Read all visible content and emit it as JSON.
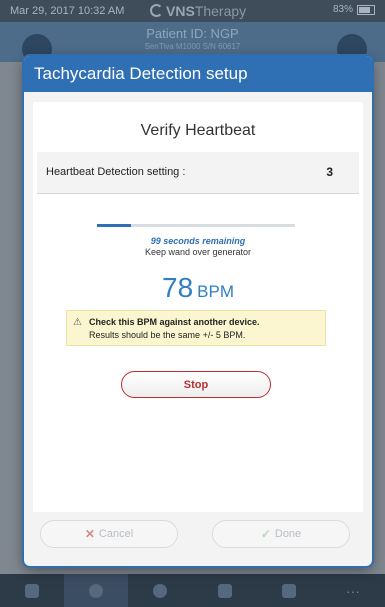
{
  "statusbar": {
    "time": "Mar 29, 2017  10:32 AM",
    "brand_bold": "VNS",
    "brand_thin": "Therapy",
    "battery": "83%"
  },
  "background": {
    "patient_id": "Patient ID: NGP",
    "model": "SenTiva M1000 S/N 60617"
  },
  "dialog": {
    "title": "Tachycardia Detection setup",
    "heading": "Verify Heartbeat",
    "setting_label": "Heartbeat Detection setting :",
    "setting_value": "3",
    "progress_fraction": 0.17,
    "remaining_text": "99 seconds remaining",
    "keep_text": "Keep wand over generator",
    "bpm_value": "78",
    "bpm_unit": "BPM",
    "warning_icon": "warning-triangle-icon",
    "warning_line1": "Check this BPM against another device.",
    "warning_line2": "Results should be the same +/- 5 BPM.",
    "stop_label": "Stop",
    "cancel_label": "Cancel",
    "done_label": "Done"
  },
  "colors": {
    "accent": "#2f6fb3",
    "stop": "#b83030",
    "warning_bg": "#fbf6cf"
  }
}
